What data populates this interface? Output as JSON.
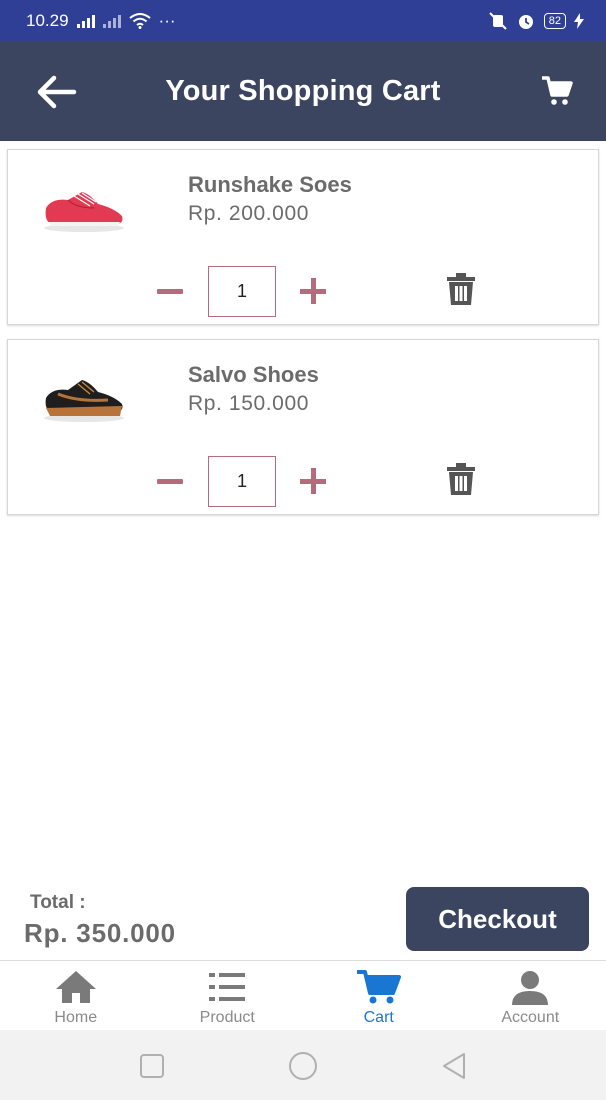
{
  "status_bar": {
    "time": "10.29",
    "signal_icon": "signal-icon",
    "wifi_icon": "wifi-icon",
    "more_icon": "more-dots-icon",
    "more_text": "···",
    "mute_icon": "mute-icon",
    "alarm_icon": "alarm-icon",
    "battery": "82",
    "charging_icon": "charging-icon"
  },
  "app_bar": {
    "title": "Your Shopping Cart",
    "back_icon": "arrow-back-icon",
    "cart_icon": "shopping-cart-icon",
    "color": "#3b4560"
  },
  "cart": {
    "items": [
      {
        "name": "Runshake Soes",
        "price": "Rp.  200.000",
        "quantity": "1",
        "image": "red-sneaker"
      },
      {
        "name": "Salvo Shoes",
        "price": "Rp.  150.000",
        "quantity": "1",
        "image": "black-brown-sneaker"
      }
    ],
    "accent_color": "#b66b7c"
  },
  "footer": {
    "total_label": "Total :",
    "total_value": "Rp.  350.000",
    "checkout_label": "Checkout"
  },
  "bottom_nav": {
    "items": [
      {
        "label": "Home",
        "icon": "home-icon",
        "active": false
      },
      {
        "label": "Product",
        "icon": "list-icon",
        "active": false
      },
      {
        "label": "Cart",
        "icon": "cart-icon",
        "active": true
      },
      {
        "label": "Account",
        "icon": "account-icon",
        "active": false
      }
    ],
    "active_color": "#1976d2"
  },
  "system_nav": {
    "recent_icon": "square-recents-icon",
    "home_icon": "circle-home-icon",
    "back_icon": "triangle-back-icon"
  }
}
